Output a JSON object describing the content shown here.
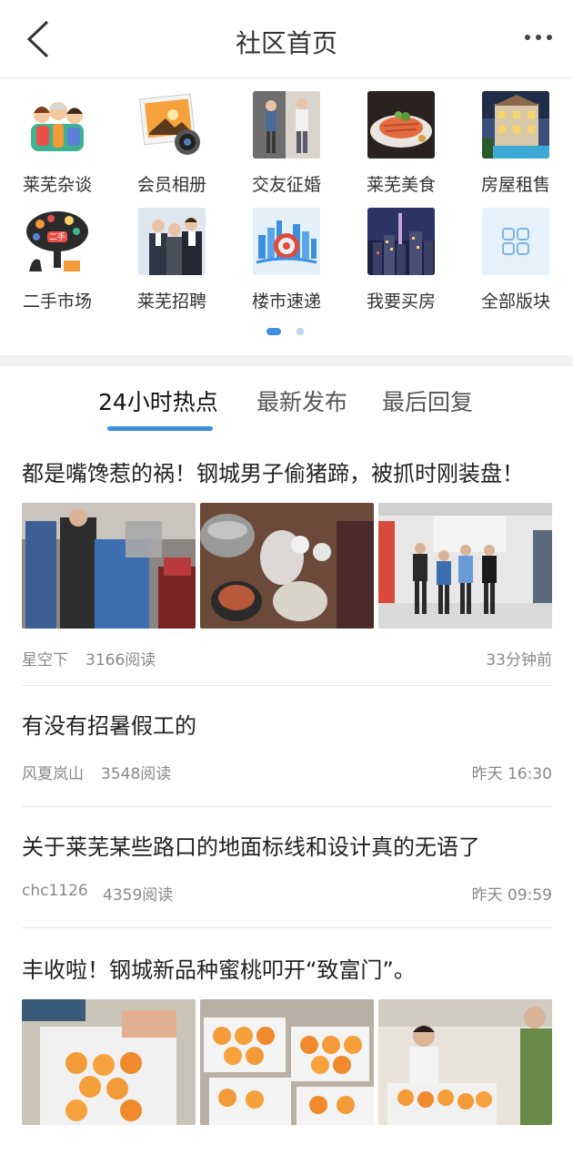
{
  "header": {
    "title": "社区首页"
  },
  "categories": [
    {
      "label": "莱芜杂谈",
      "icon": "family-cartoon-icon"
    },
    {
      "label": "会员相册",
      "icon": "photo-album-icon"
    },
    {
      "label": "交友征婚",
      "icon": "couple-photo-icon"
    },
    {
      "label": "莱芜美食",
      "icon": "food-dish-icon"
    },
    {
      "label": "房屋租售",
      "icon": "house-building-icon"
    },
    {
      "label": "二手市场",
      "icon": "second-hand-tree-icon"
    },
    {
      "label": "莱芜招聘",
      "icon": "business-people-icon"
    },
    {
      "label": "楼市速递",
      "icon": "city-skyline-icon"
    },
    {
      "label": "我要买房",
      "icon": "night-city-icon"
    },
    {
      "label": "全部版块",
      "icon": "grid-icon"
    }
  ],
  "pagination": {
    "total": 2,
    "active": 1
  },
  "tabs": [
    {
      "label": "24小时热点",
      "active": true
    },
    {
      "label": "最新发布",
      "active": false
    },
    {
      "label": "最后回复",
      "active": false
    }
  ],
  "posts": [
    {
      "title": "都是嘴馋惹的祸！钢城男子偷猪蹄，被抓时刚装盘！",
      "author": "星空下",
      "reads": "3166阅读",
      "time": "33分钟前",
      "has_images": true
    },
    {
      "title": "有没有招暑假工的",
      "author": "风夏岚山",
      "reads": "3548阅读",
      "time": "昨天 16:30",
      "has_images": false
    },
    {
      "title": "关于莱芜某些路口的地面标线和设计真的无语了",
      "author": "chc1126",
      "reads": "4359阅读",
      "time": "昨天 09:59",
      "has_images": false
    },
    {
      "title": "丰收啦！钢城新品种蜜桃叩开“致富门”。",
      "has_images": true
    }
  ],
  "colors": {
    "accent": "#3d8fe0",
    "separator": "#f2f2f2"
  }
}
